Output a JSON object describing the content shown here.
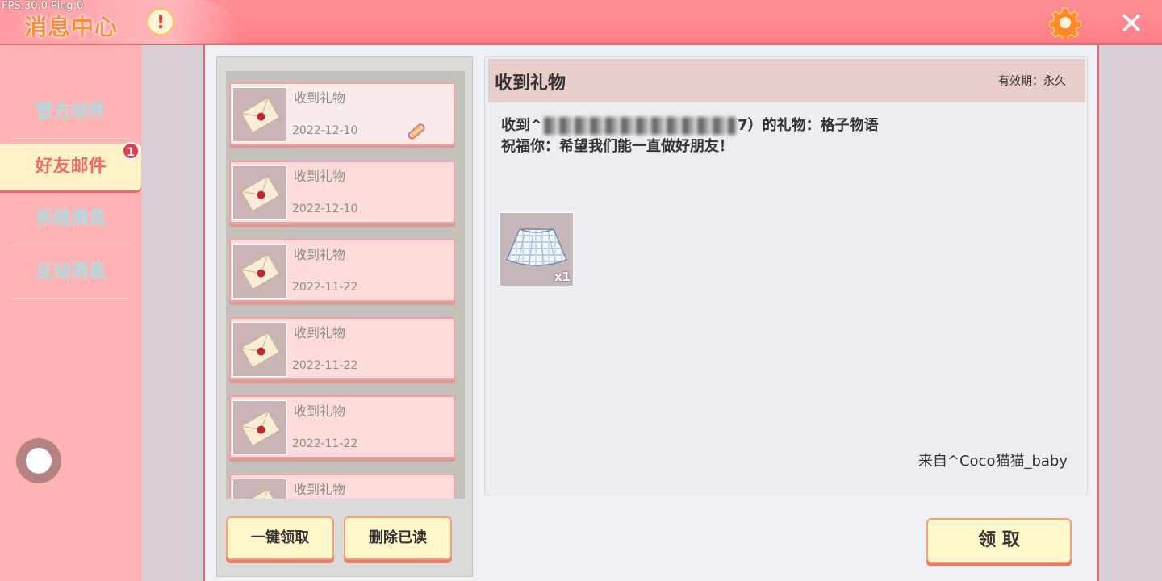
{
  "debug": {
    "fps": "FPS:30.0  Ping:0"
  },
  "header": {
    "title": "消息中心",
    "warn_symbol": "!",
    "close_symbol": "✕"
  },
  "sidebar": {
    "tabs": [
      {
        "label": "官方邮件"
      },
      {
        "label": "好友邮件",
        "badge": "1"
      },
      {
        "label": "系统消息"
      },
      {
        "label": "互动消息"
      }
    ]
  },
  "mail_list": {
    "items": [
      {
        "title": "收到礼物",
        "date": "2022-12-10"
      },
      {
        "title": "收到礼物",
        "date": "2022-12-10"
      },
      {
        "title": "收到礼物",
        "date": "2022-11-22"
      },
      {
        "title": "收到礼物",
        "date": "2022-11-22"
      },
      {
        "title": "收到礼物",
        "date": "2022-11-22"
      },
      {
        "title": "收到礼物",
        "date": ""
      }
    ],
    "claim_all_label": "一键领取",
    "delete_read_label": "删除已读"
  },
  "detail": {
    "title": "收到礼物",
    "validity": "有效期：永久",
    "line1_prefix": "收到^",
    "line1_suffix": "7）的礼物：格子物语",
    "line2": "祝福你：希望我们能一直做好朋友！",
    "item_count": "x1",
    "sender": "来自^Coco猫猫_baby",
    "claim_label": "领 取"
  },
  "colors": {
    "topbar": "#ff7f88",
    "sidebar": "#ffb3b3",
    "active_tab": "#fff1c7",
    "mail_item": "#ffdcdc",
    "button": "#fff6c9"
  }
}
